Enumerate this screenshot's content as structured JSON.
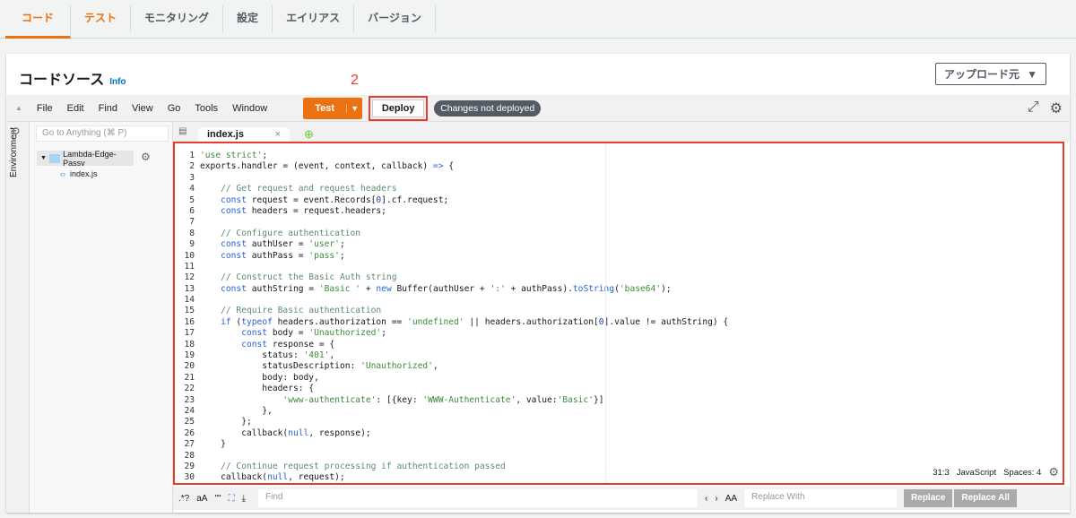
{
  "tabs": [
    "コード",
    "テスト",
    "モニタリング",
    "設定",
    "エイリアス",
    "バージョン"
  ],
  "panel": {
    "title": "コードソース",
    "info": "Info",
    "upload": "アップロード元",
    "annotations": [
      "1",
      "2"
    ]
  },
  "toolbar": {
    "menus": [
      "File",
      "Edit",
      "Find",
      "View",
      "Go",
      "Tools",
      "Window"
    ],
    "test": "Test",
    "deploy": "Deploy",
    "badge": "Changes not deployed"
  },
  "sidebar": {
    "vertical_tab": "Environment",
    "goto_placeholder": "Go to Anything (⌘ P)",
    "folder": "Lambda-Edge-Passv",
    "file": "index.js"
  },
  "editor": {
    "tab": "index.js",
    "lines": [
      [
        [
          "s",
          "'use strict'"
        ],
        [
          "p",
          ";"
        ]
      ],
      [
        [
          "p",
          "exports.handler = (event, context, callback) "
        ],
        [
          "k",
          "=>"
        ],
        [
          "p",
          " {"
        ]
      ],
      [],
      [
        [
          "c",
          "    // Get request and request headers"
        ]
      ],
      [
        [
          "k",
          "    const"
        ],
        [
          "p",
          " request = event.Records["
        ],
        [
          "n",
          "0"
        ],
        [
          "p",
          "].cf.request;"
        ]
      ],
      [
        [
          "k",
          "    const"
        ],
        [
          "p",
          " headers = request.headers;"
        ]
      ],
      [],
      [
        [
          "c",
          "    // Configure authentication"
        ]
      ],
      [
        [
          "k",
          "    const"
        ],
        [
          "p",
          " authUser = "
        ],
        [
          "s",
          "'user'"
        ],
        [
          "p",
          ";"
        ]
      ],
      [
        [
          "k",
          "    const"
        ],
        [
          "p",
          " authPass = "
        ],
        [
          "s",
          "'pass'"
        ],
        [
          "p",
          ";"
        ]
      ],
      [],
      [
        [
          "c",
          "    // Construct the Basic Auth string"
        ]
      ],
      [
        [
          "k",
          "    const"
        ],
        [
          "p",
          " authString = "
        ],
        [
          "s",
          "'Basic '"
        ],
        [
          "p",
          " + "
        ],
        [
          "k",
          "new"
        ],
        [
          "p",
          " Buffer(authUser + "
        ],
        [
          "s",
          "':'"
        ],
        [
          "p",
          " + authPass)."
        ],
        [
          "k",
          "toString"
        ],
        [
          "p",
          "("
        ],
        [
          "s",
          "'base64'"
        ],
        [
          "p",
          ");"
        ]
      ],
      [],
      [
        [
          "c",
          "    // Require Basic authentication"
        ]
      ],
      [
        [
          "k",
          "    if"
        ],
        [
          "p",
          " ("
        ],
        [
          "k",
          "typeof"
        ],
        [
          "p",
          " headers.authorization == "
        ],
        [
          "s",
          "'undefined'"
        ],
        [
          "p",
          " || headers.authorization["
        ],
        [
          "n",
          "0"
        ],
        [
          "p",
          "].value != authString) {"
        ]
      ],
      [
        [
          "k",
          "        const"
        ],
        [
          "p",
          " body = "
        ],
        [
          "s",
          "'Unauthorized'"
        ],
        [
          "p",
          ";"
        ]
      ],
      [
        [
          "k",
          "        const"
        ],
        [
          "p",
          " response = {"
        ]
      ],
      [
        [
          "p",
          "            status: "
        ],
        [
          "s",
          "'401'"
        ],
        [
          "p",
          ","
        ]
      ],
      [
        [
          "p",
          "            statusDescription: "
        ],
        [
          "s",
          "'Unauthorized'"
        ],
        [
          "p",
          ","
        ]
      ],
      [
        [
          "p",
          "            body: body,"
        ]
      ],
      [
        [
          "p",
          "            headers: {"
        ]
      ],
      [
        [
          "s",
          "                'www-authenticate'"
        ],
        [
          "p",
          ": [{key: "
        ],
        [
          "s",
          "'WWW-Authenticate'"
        ],
        [
          "p",
          ", value:"
        ],
        [
          "s",
          "'Basic'"
        ],
        [
          "p",
          "}]"
        ]
      ],
      [
        [
          "p",
          "            },"
        ]
      ],
      [
        [
          "p",
          "        };"
        ]
      ],
      [
        [
          "p",
          "        callback("
        ],
        [
          "k",
          "null"
        ],
        [
          "p",
          ", response);"
        ]
      ],
      [
        [
          "p",
          "    }"
        ]
      ],
      [],
      [
        [
          "c",
          "    // Continue request processing if authentication passed"
        ]
      ],
      [
        [
          "p",
          "    callback("
        ],
        [
          "k",
          "null"
        ],
        [
          "p",
          ", request);"
        ]
      ]
    ],
    "status": {
      "position": "31:3",
      "language": "JavaScript",
      "spaces": "Spaces: 4"
    }
  },
  "findbar": {
    "options": [
      ".*?",
      "aA",
      "\"\""
    ],
    "find_placeholder": "Find",
    "replace_placeholder": "Replace With",
    "replace": "Replace",
    "replace_all": "Replace All"
  }
}
